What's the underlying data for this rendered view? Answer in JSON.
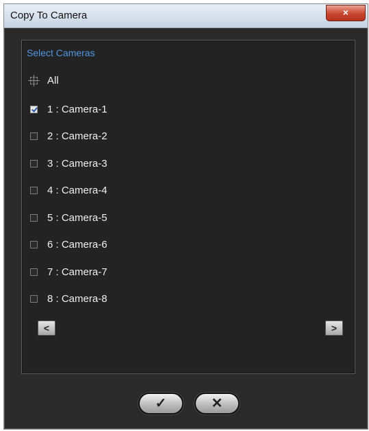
{
  "window": {
    "title": "Copy To Camera",
    "close_label": "×"
  },
  "panel": {
    "section_label": "Select Cameras",
    "all_label": "All",
    "cameras": [
      {
        "label": "1 : Camera-1",
        "checked": true
      },
      {
        "label": "2 : Camera-2",
        "checked": false
      },
      {
        "label": "3 : Camera-3",
        "checked": false
      },
      {
        "label": "4 : Camera-4",
        "checked": false
      },
      {
        "label": "5 : Camera-5",
        "checked": false
      },
      {
        "label": "6 : Camera-6",
        "checked": false
      },
      {
        "label": "7 : Camera-7",
        "checked": false
      },
      {
        "label": "8 : Camera-8",
        "checked": false
      }
    ],
    "prev_label": "<",
    "next_label": ">"
  },
  "buttons": {
    "ok_label": "✓",
    "cancel_label": "✕"
  },
  "colors": {
    "accent": "#4f96e0",
    "dialog_bg": "#2a2a2a",
    "panel_bg": "#232323"
  }
}
